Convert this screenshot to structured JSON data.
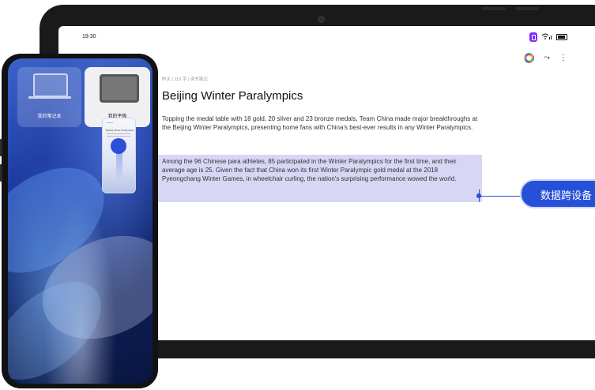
{
  "status_bar": {
    "time": "19:30",
    "wifi_icon": "wifi-signal-icon",
    "battery_icon": "battery-icon",
    "app_badge_color": "#7b2ff7"
  },
  "toolbar": {
    "color_ring_icon": "color-picker-icon",
    "share_icon": "share-icon",
    "more_icon": "more-vertical-icon",
    "share_glyph": "⤳",
    "more_glyph": "⋮"
  },
  "document": {
    "meta": "昨天 | 115 字 | 读书笔记",
    "title": "Beijing Winter Paralympics",
    "paragraph1": "Topping the medal table with 18 gold, 20 silver and 23 bronze medals, Team China made major breakthroughs at the Beijing Winter Paralympics, presenting home fans with China's best-ever results in any Winter Paralympics.",
    "paragraph2": "Among the 96 Chinese para athletes, 85 participated in the Winter Paralympics for the first time, and their average age is 25. Given the fact that China won its first Winter Paralympic gold medal at the 2018 Pyeongchang Winter Games, in wheelchair curling, the nation's surprising performance wowed the world.",
    "selection_color": "#d7d7f5"
  },
  "callout": {
    "label": "数据跨设备",
    "color": "#2750d9"
  },
  "phone": {
    "devices": [
      {
        "label": "我的笔记本",
        "icon": "laptop-icon"
      },
      {
        "label": "我的平板",
        "icon": "tablet-icon"
      }
    ],
    "mini_preview_title": "Beijing Winter Paralympics"
  }
}
